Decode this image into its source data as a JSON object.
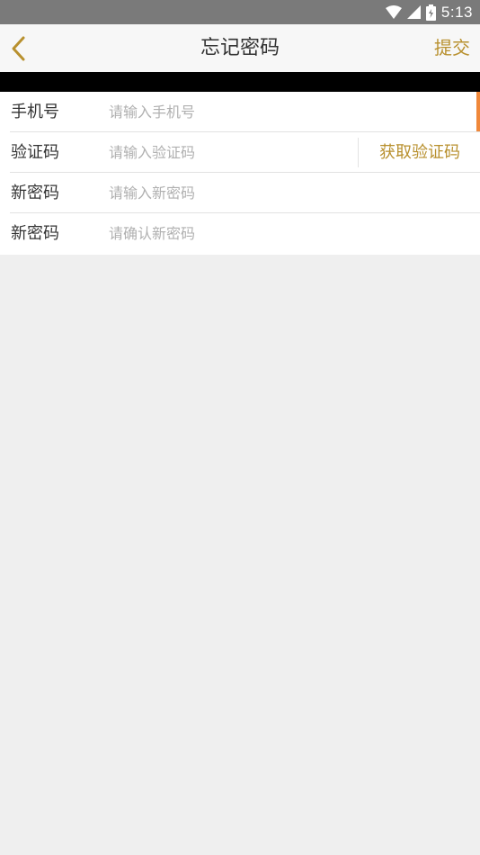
{
  "status_bar": {
    "time": "5:13",
    "icons": [
      "wifi-icon",
      "signal-icon",
      "battery-icon"
    ]
  },
  "nav": {
    "back_icon": "back-chevron-icon",
    "title": "忘记密码",
    "submit_label": "提交"
  },
  "form": {
    "phone": {
      "label": "手机号",
      "placeholder": "请输入手机号"
    },
    "code": {
      "label": "验证码",
      "placeholder": "请输入验证码",
      "button_label": "获取验证码"
    },
    "new_password": {
      "label": "新密码",
      "placeholder": "请输入新密码"
    },
    "confirm_password": {
      "label": "新密码",
      "placeholder": "请确认新密码"
    }
  },
  "colors": {
    "accent": "#b8902e",
    "focus_caret": "#f0883a",
    "status_bar": "#7a7a7a",
    "nav_bg": "#f7f7f7",
    "page_bg": "#efefef"
  }
}
